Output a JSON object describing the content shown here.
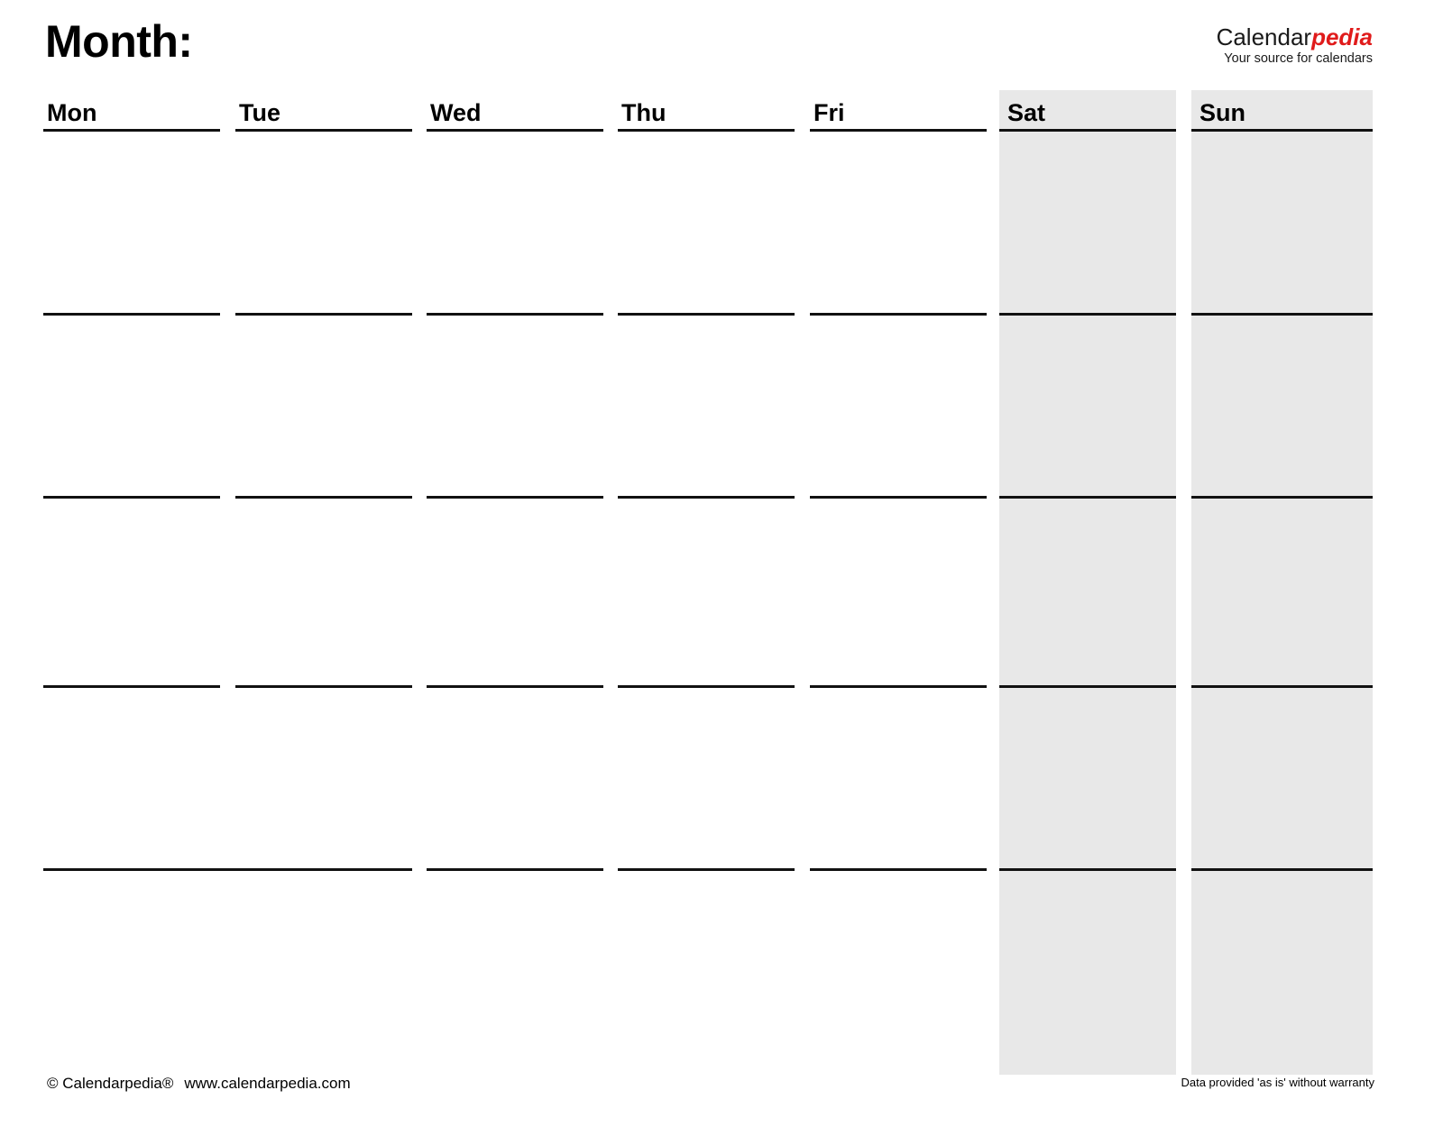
{
  "header": {
    "title": "Month:",
    "brand": {
      "word_part_1": "Calendar",
      "word_part_2": "pedia",
      "tagline": "Your source for calendars",
      "accent_color": "#e01b1b"
    }
  },
  "calendar": {
    "weekend_shade_color": "#e8e8e8",
    "line_color": "#111111",
    "columns": [
      {
        "label": "Mon",
        "weekend": false
      },
      {
        "label": "Tue",
        "weekend": false
      },
      {
        "label": "Wed",
        "weekend": false
      },
      {
        "label": "Thu",
        "weekend": false
      },
      {
        "label": "Fri",
        "weekend": false
      },
      {
        "label": "Sat",
        "weekend": true
      },
      {
        "label": "Sun",
        "weekend": true
      }
    ],
    "week_rows": 5,
    "cells": [
      [
        "",
        "",
        "",
        "",
        "",
        "",
        ""
      ],
      [
        "",
        "",
        "",
        "",
        "",
        "",
        ""
      ],
      [
        "",
        "",
        "",
        "",
        "",
        "",
        ""
      ],
      [
        "",
        "",
        "",
        "",
        "",
        "",
        ""
      ],
      [
        "",
        "",
        "",
        "",
        "",
        "",
        ""
      ]
    ]
  },
  "footer": {
    "copyright": "© Calendarpedia®",
    "website": "www.calendarpedia.com",
    "disclaimer": "Data provided 'as is' without warranty"
  }
}
